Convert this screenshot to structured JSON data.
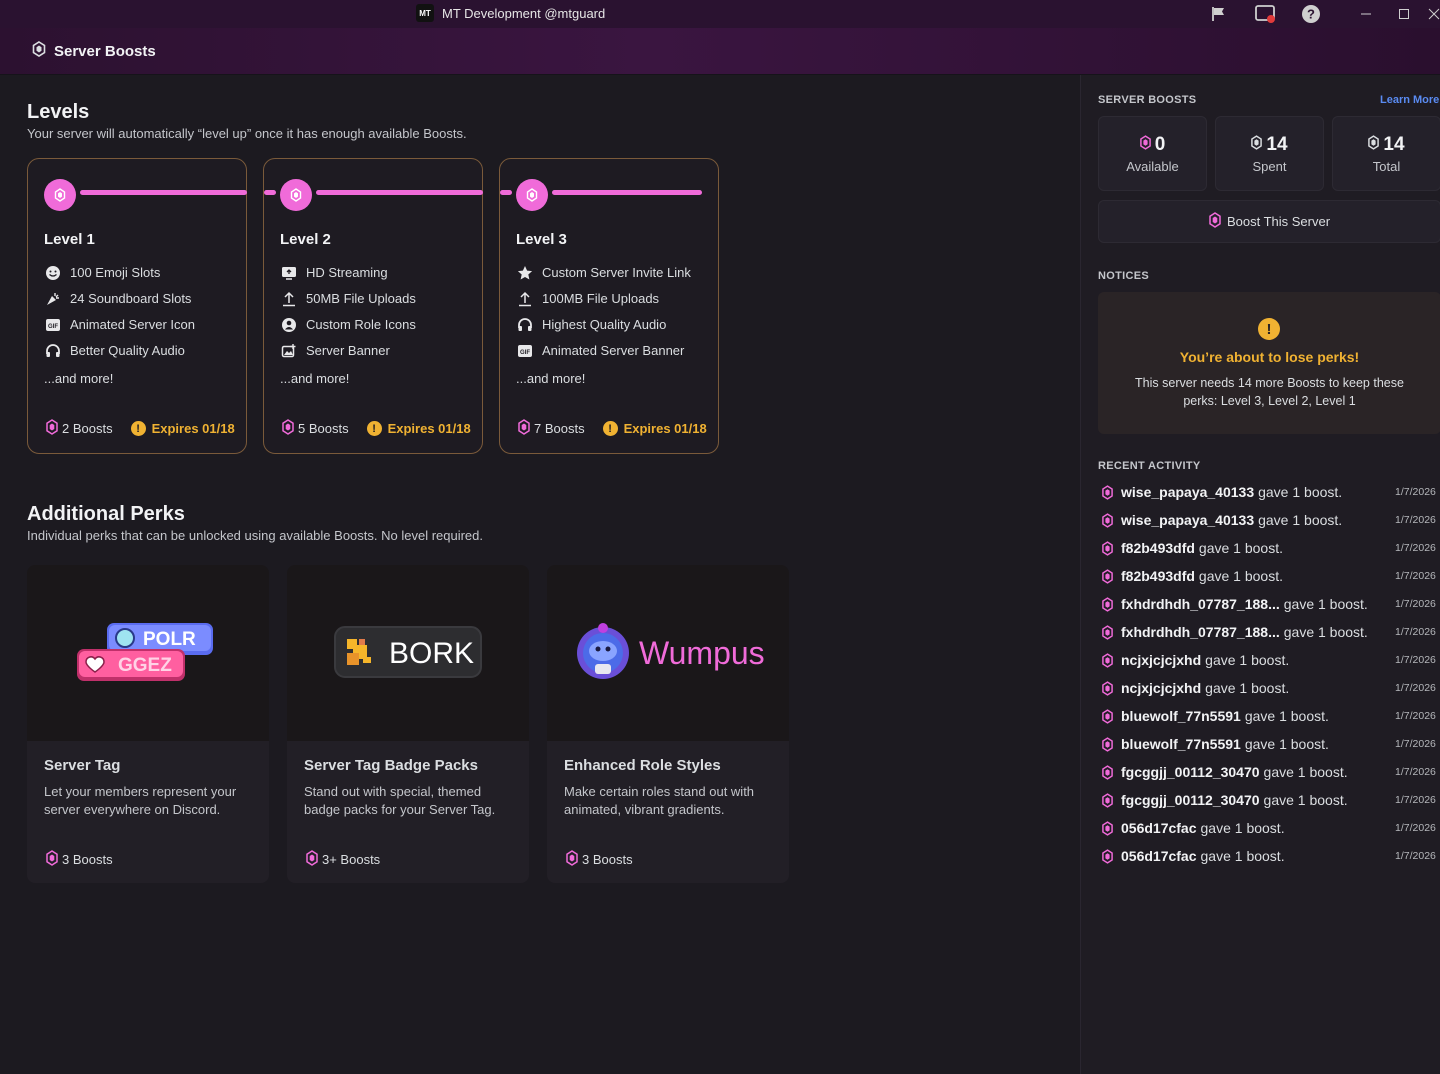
{
  "window": {
    "app_badge": "MT",
    "title": "MT Development @mtguard"
  },
  "header": {
    "title": "Server Boosts"
  },
  "levels": {
    "title": "Levels",
    "subtitle": "Your server will automatically “level up” once it has enough available Boosts.",
    "cards": [
      {
        "label": "Level 1",
        "perks": [
          {
            "icon": "emoji-icon",
            "label": "100 Emoji Slots"
          },
          {
            "icon": "soundboard-icon",
            "label": "24 Soundboard Slots"
          },
          {
            "icon": "gif-icon",
            "label": "Animated Server Icon"
          },
          {
            "icon": "headphones-icon",
            "label": "Better Quality Audio"
          }
        ],
        "more": "...and more!",
        "boosts": "2 Boosts",
        "expires": "Expires 01/18"
      },
      {
        "label": "Level 2",
        "perks": [
          {
            "icon": "screen-share-icon",
            "label": "HD Streaming"
          },
          {
            "icon": "upload-icon",
            "label": "50MB File Uploads"
          },
          {
            "icon": "role-icon",
            "label": "Custom Role Icons"
          },
          {
            "icon": "image-icon",
            "label": "Server Banner"
          }
        ],
        "more": "...and more!",
        "boosts": "5 Boosts",
        "expires": "Expires 01/18"
      },
      {
        "label": "Level 3",
        "perks": [
          {
            "icon": "star-icon",
            "label": "Custom Server Invite Link"
          },
          {
            "icon": "upload-icon",
            "label": "100MB File Uploads"
          },
          {
            "icon": "headphones-icon",
            "label": "Highest Quality Audio"
          },
          {
            "icon": "gif-icon",
            "label": "Animated Server Banner"
          }
        ],
        "more": "...and more!",
        "boosts": "7 Boosts",
        "expires": "Expires 01/18"
      }
    ]
  },
  "additional": {
    "title": "Additional Perks",
    "subtitle": "Individual perks that can be unlocked using available Boosts. No level required.",
    "cards": [
      {
        "art_text_1": "POLR",
        "art_text_2": "GGEZ",
        "title": "Server Tag",
        "desc": "Let your members represent your server everywhere on Discord.",
        "cost": "3 Boosts"
      },
      {
        "art_text_1": "BORK",
        "title": "Server Tag Badge Packs",
        "desc": "Stand out with special, themed badge packs for your Server Tag.",
        "cost": "3+ Boosts"
      },
      {
        "art_text_1": "Wumpus",
        "title": "Enhanced Role Styles",
        "desc": "Make certain roles stand out with animated, vibrant gradients.",
        "cost": "3 Boosts"
      }
    ]
  },
  "sidebar": {
    "boosts_heading": "SERVER BOOSTS",
    "learn_more": "Learn More",
    "stats": [
      {
        "value": "0",
        "label": "Available"
      },
      {
        "value": "14",
        "label": "Spent"
      },
      {
        "value": "14",
        "label": "Total"
      }
    ],
    "boost_button": "Boost This Server",
    "notices_heading": "NOTICES",
    "notice": {
      "title": "You’re about to lose perks!",
      "body": "This server needs 14 more Boosts to keep these perks: Level 3, Level 2, Level 1"
    },
    "activity_heading": "RECENT ACTIVITY",
    "activity": [
      {
        "user": "wise_papaya_40133",
        "action": "gave 1 boost.",
        "date": "1/7/2026"
      },
      {
        "user": "wise_papaya_40133",
        "action": "gave 1 boost.",
        "date": "1/7/2026"
      },
      {
        "user": "f82b493dfd",
        "action": "gave 1 boost.",
        "date": "1/7/2026"
      },
      {
        "user": "f82b493dfd",
        "action": "gave 1 boost.",
        "date": "1/7/2026"
      },
      {
        "user": "fxhdrdhdh_07787_188...",
        "action": "gave 1 boost.",
        "date": "1/7/2026"
      },
      {
        "user": "fxhdrdhdh_07787_188...",
        "action": "gave 1 boost.",
        "date": "1/7/2026"
      },
      {
        "user": "ncjxjcjcjxhd",
        "action": "gave 1 boost.",
        "date": "1/7/2026"
      },
      {
        "user": "ncjxjcjcjxhd",
        "action": "gave 1 boost.",
        "date": "1/7/2026"
      },
      {
        "user": "bluewolf_77n5591",
        "action": "gave 1 boost.",
        "date": "1/7/2026"
      },
      {
        "user": "bluewolf_77n5591",
        "action": "gave 1 boost.",
        "date": "1/7/2026"
      },
      {
        "user": "fgcggjj_00112_30470",
        "action": "gave 1 boost.",
        "date": "1/7/2026"
      },
      {
        "user": "fgcggjj_00112_30470",
        "action": "gave 1 boost.",
        "date": "1/7/2026"
      },
      {
        "user": "056d17cfac",
        "action": "gave 1 boost.",
        "date": "1/7/2026"
      },
      {
        "user": "056d17cfac",
        "action": "gave 1 boost.",
        "date": "1/7/2026"
      }
    ]
  },
  "colors": {
    "accent_pink": "#f06bd9",
    "warning": "#f0b232",
    "link": "#5a8bf2"
  }
}
